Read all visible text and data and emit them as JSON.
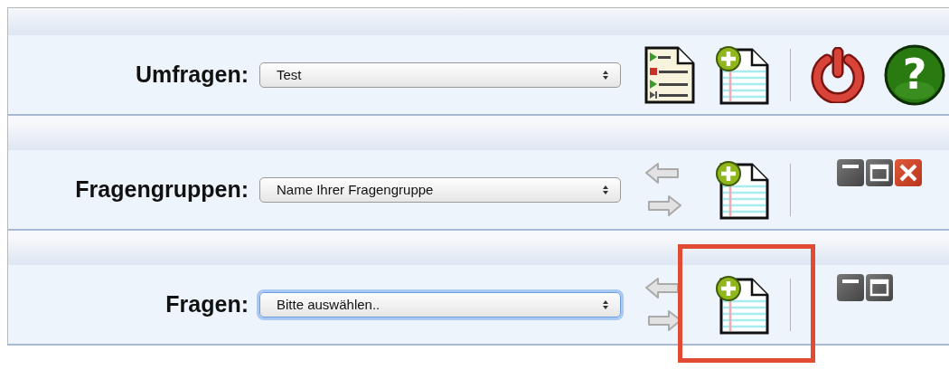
{
  "sections": [
    {
      "label": "Umfragen:",
      "select": {
        "value": "Test",
        "focused": false
      },
      "tools": [
        {
          "kind": "list-doc"
        },
        {
          "kind": "new-doc"
        },
        {
          "kind": "separator"
        },
        {
          "kind": "power"
        },
        {
          "kind": "help",
          "glyph": "?"
        }
      ]
    },
    {
      "label": "Fragengruppen:",
      "select": {
        "value": "Name Ihrer Fragengruppe",
        "focused": false
      },
      "tools": [
        {
          "kind": "arrows"
        },
        {
          "kind": "new-doc"
        },
        {
          "kind": "separator"
        }
      ],
      "window_controls": [
        {
          "kind": "minimize"
        },
        {
          "kind": "maximize"
        },
        {
          "kind": "close"
        }
      ]
    },
    {
      "label": "Fragen:",
      "select": {
        "value": "Bitte auswählen..",
        "focused": true
      },
      "tools": [
        {
          "kind": "arrows"
        },
        {
          "kind": "new-doc",
          "highlighted": true
        },
        {
          "kind": "separator"
        }
      ],
      "window_controls": [
        {
          "kind": "minimize"
        },
        {
          "kind": "maximize"
        }
      ]
    }
  ]
}
